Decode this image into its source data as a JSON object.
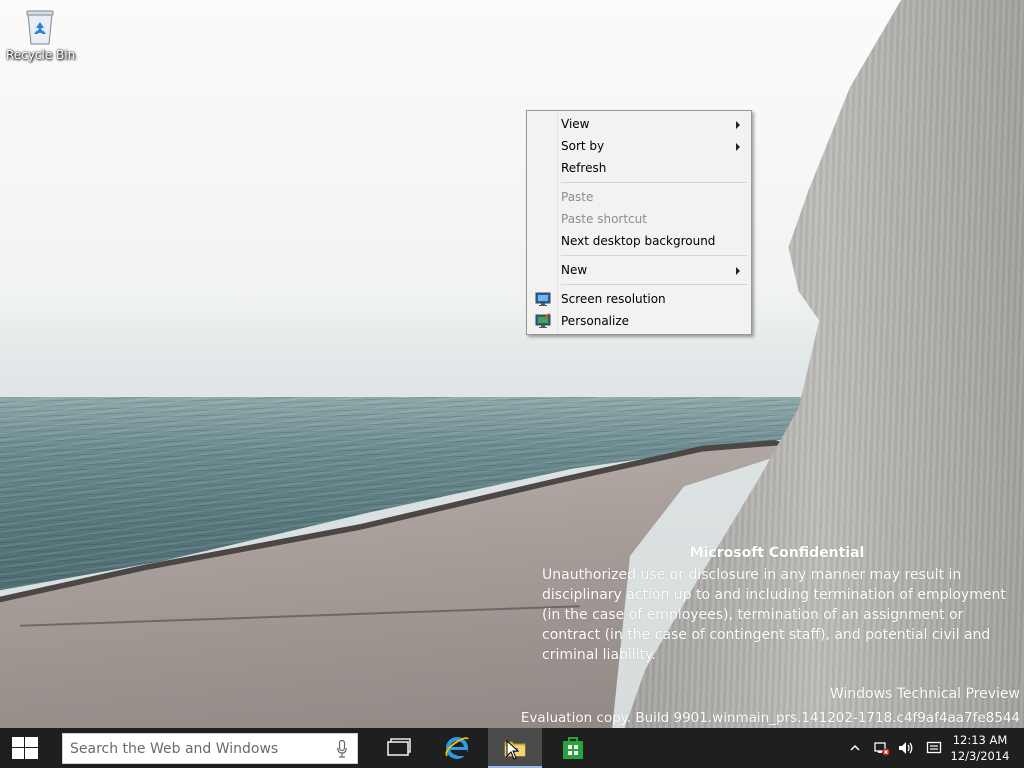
{
  "desktop": {
    "icons": [
      {
        "label": "Recycle Bin",
        "icon": "recycle-bin-icon"
      }
    ]
  },
  "context_menu": {
    "items": [
      {
        "label": "View",
        "submenu": true,
        "enabled": true
      },
      {
        "label": "Sort by",
        "submenu": true,
        "enabled": true
      },
      {
        "label": "Refresh",
        "submenu": false,
        "enabled": true
      },
      {
        "label": "Paste",
        "submenu": false,
        "enabled": false
      },
      {
        "label": "Paste shortcut",
        "submenu": false,
        "enabled": false
      },
      {
        "label": "Next desktop background",
        "submenu": false,
        "enabled": true
      },
      {
        "label": "New",
        "submenu": true,
        "enabled": true
      },
      {
        "label": "Screen resolution",
        "submenu": false,
        "enabled": true,
        "icon": "screen-resolution-icon"
      },
      {
        "label": "Personalize",
        "submenu": false,
        "enabled": true,
        "icon": "personalize-icon"
      }
    ]
  },
  "watermark": {
    "title": "Microsoft Confidential",
    "body": "Unauthorized use or disclosure in any manner may result in disciplinary action up to and including termination of employment (in the case of employees), termination of an assignment or contract (in the case of contingent staff), and potential civil and criminal liability.",
    "edition": "Windows Technical Preview",
    "build": "Evaluation copy. Build 9901.winmain_prs.141202-1718.c4f9af4aa7fe8544"
  },
  "taskbar": {
    "search_placeholder": "Search the Web and Windows",
    "pinned": [
      {
        "name": "task-view",
        "icon": "task-view-icon",
        "active": false
      },
      {
        "name": "internet-explorer",
        "icon": "internet-explorer-icon",
        "active": false
      },
      {
        "name": "file-explorer",
        "icon": "file-explorer-icon",
        "active": true
      },
      {
        "name": "store",
        "icon": "store-icon",
        "active": false
      }
    ],
    "tray": {
      "icons": [
        "show-hidden-icons-icon",
        "network-disconnected-icon",
        "volume-icon",
        "action-center-icon"
      ],
      "time": "12:13 AM",
      "date": "12/3/2014"
    }
  },
  "colors": {
    "taskbar": "#1f1f1f",
    "menu_bg": "#f2f2f2",
    "menu_disabled_text": "#8c8c8c",
    "accent": "#9dbbe0"
  }
}
